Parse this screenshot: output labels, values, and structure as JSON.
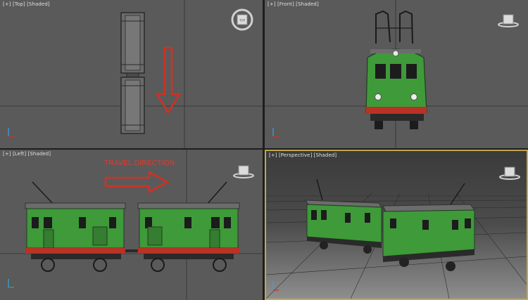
{
  "viewports": {
    "top": {
      "plus": "[+]",
      "view": "[Top]",
      "mode": "[Shaded]"
    },
    "front": {
      "plus": "[+]",
      "view": "[Front]",
      "mode": "[Shaded]"
    },
    "left": {
      "plus": "[+]",
      "view": "[Left]",
      "mode": "[Shaded]"
    },
    "perspective": {
      "plus": "[+]",
      "view": "[Perspective]",
      "mode": "[Shaded]"
    }
  },
  "annotation": {
    "travel_direction": "TRAVEL DIRECTION"
  },
  "navcube": {
    "top_label": "TOP"
  },
  "colors": {
    "body_green": "#3f9a3a",
    "roof_gray": "#7a7a7a",
    "arrow_red": "#d23023",
    "active_border": "#c2a653"
  }
}
